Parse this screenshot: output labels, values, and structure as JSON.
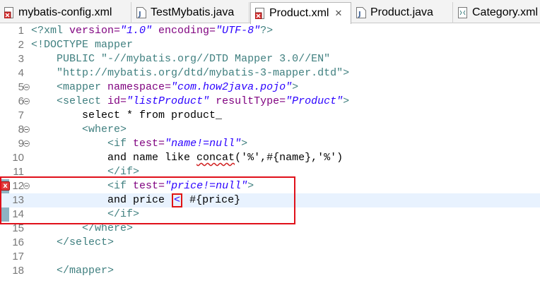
{
  "tabs": [
    {
      "label": "mybatis-config.xml",
      "icon": "xml-file-error-icon",
      "active": false
    },
    {
      "label": "TestMybatis.java",
      "icon": "java-file-icon",
      "active": false
    },
    {
      "label": "Product.xml",
      "icon": "xml-file-error-icon",
      "active": true,
      "close": "✕"
    },
    {
      "label": "Product.java",
      "icon": "java-file-icon",
      "active": false
    },
    {
      "label": "Category.xml",
      "icon": "xml-file-icon",
      "active": false
    }
  ],
  "editor": {
    "current_line": 13,
    "error_line": 12,
    "error_marker": "x",
    "lines": {
      "l1": {
        "num": "1"
      },
      "l2": {
        "num": "2"
      },
      "l3": {
        "num": "3"
      },
      "l4": {
        "num": "4"
      },
      "l5": {
        "num": "5"
      },
      "l6": {
        "num": "6"
      },
      "l7": {
        "num": "7",
        "text": "        select * from product_"
      },
      "l8": {
        "num": "8"
      },
      "l9": {
        "num": "9"
      },
      "l10": {
        "num": "10",
        "text": "            and name like "
      },
      "l11": {
        "num": "11"
      },
      "l12": {
        "num": "12"
      },
      "l13": {
        "num": "13",
        "text_before": "            and price ",
        "lt": "<",
        "text_after": " #{price}"
      },
      "l14": {
        "num": "14"
      },
      "l15": {
        "num": "15"
      },
      "l16": {
        "num": "16"
      },
      "l17": {
        "num": "17"
      },
      "l18": {
        "num": "18"
      }
    },
    "tokens": {
      "xml_decl_start": "<?xml ",
      "version_attr": "version=",
      "version_val": "\"1.0\"",
      "encoding_attr": " encoding=",
      "encoding_val": "\"UTF-8\"",
      "xml_decl_end": "?>",
      "doctype": "<!DOCTYPE mapper",
      "public": "    PUBLIC ",
      "public_id": "\"-//mybatis.org//DTD Mapper 3.0//EN\"",
      "system_id": "    \"http://mybatis.org/dtd/mybatis-3-mapper.dtd\">",
      "mapper_open": "<mapper ",
      "namespace_attr": "namespace=",
      "namespace_val": "\"com.how2java.pojo\"",
      "gt": ">",
      "select_open": "<select ",
      "id_attr": "id=",
      "id_val": "\"listProduct\"",
      "resulttype_attr": " resultType=",
      "resulttype_val": "\"Product\"",
      "where_open": "<where>",
      "if_open": "<if ",
      "test_attr": "test=",
      "test_name_val": "\"name!=null\"",
      "concat_word": "concat",
      "concat_rest": "('%',#{name},'%')",
      "if_close": "</if>",
      "test_price_val": "\"price!=null\"",
      "where_close": "</where>",
      "select_close": "</select>",
      "mapper_close": "</mapper>"
    }
  }
}
